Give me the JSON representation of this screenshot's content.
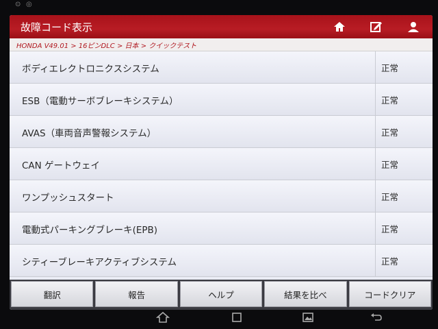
{
  "header": {
    "title": "故障コード表示"
  },
  "breadcrumb": "HONDA V49.01 > 16ピンDLC > 日本 > クイックテスト",
  "systems": [
    {
      "name": "ボディエレクトロニクスシステム",
      "status": "正常"
    },
    {
      "name": "ESB（電動サーボブレーキシステム）",
      "status": "正常"
    },
    {
      "name": "AVAS（車両音声警報システム）",
      "status": "正常"
    },
    {
      "name": "CAN ゲートウェイ",
      "status": "正常"
    },
    {
      "name": "ワンプッシュスタート",
      "status": "正常"
    },
    {
      "name": "電動式パーキングブレーキ(EPB)",
      "status": "正常"
    },
    {
      "name": "シティーブレーキアクティブシステム",
      "status": "正常"
    }
  ],
  "buttons": {
    "translate": "翻訳",
    "report": "報告",
    "help": "ヘルプ",
    "compare": "結果を比べ",
    "clear": "コードクリア"
  },
  "icons": {
    "home": "home-icon",
    "report": "edit-icon",
    "user": "user-icon"
  },
  "colors": {
    "accent": "#b0171f"
  }
}
